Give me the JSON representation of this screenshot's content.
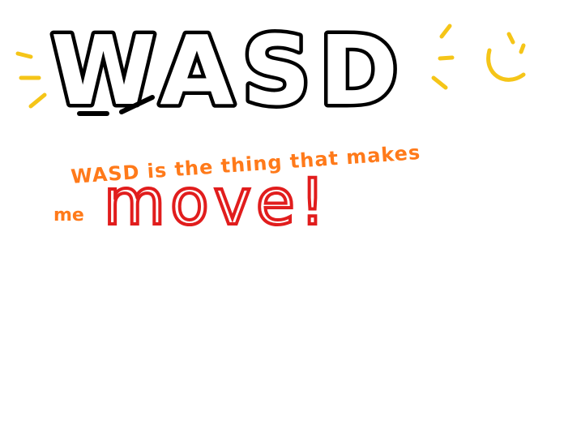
{
  "drawing": {
    "title": "WASD",
    "line1": "WASD is the thing that makes",
    "line2_prefix": "me",
    "line2_emphasis": "move!",
    "icons": [
      "sun-rays-icon",
      "smiley-face-icon"
    ],
    "colors": {
      "background": "#ffffff",
      "outline": "#000000",
      "orange_text": "#ff7a1a",
      "red_text": "#e11d1d",
      "yellow_doodle": "#f5c518"
    }
  }
}
